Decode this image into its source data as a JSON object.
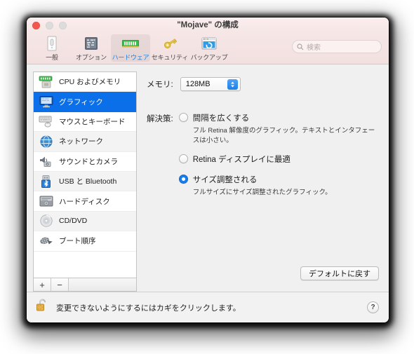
{
  "window": {
    "title": "\"Mojave\" の構成",
    "traffic_lights": [
      "close",
      "minimize",
      "zoom"
    ]
  },
  "toolbar": {
    "items": [
      {
        "label": "一般",
        "icon": "general-document-icon",
        "selected": false
      },
      {
        "label": "オプション",
        "icon": "options-circuit-icon",
        "selected": false
      },
      {
        "label": "ハードウェア",
        "icon": "hardware-memory-icon",
        "selected": true
      },
      {
        "label": "セキュリティ",
        "icon": "security-key-icon",
        "selected": false
      },
      {
        "label": "バックアップ",
        "icon": "backup-window-icon",
        "selected": false
      }
    ],
    "search": {
      "placeholder": "検索",
      "value": "",
      "icon": "search-icon"
    }
  },
  "sidebar": {
    "items": [
      {
        "label": "CPU およびメモリ",
        "icon": "cpu-memory-icon",
        "selected": false
      },
      {
        "label": "グラフィック",
        "icon": "display-icon",
        "selected": true
      },
      {
        "label": "マウスとキーボード",
        "icon": "keyboard-mouse-icon",
        "selected": false
      },
      {
        "label": "ネットワーク",
        "icon": "network-globe-icon",
        "selected": false
      },
      {
        "label": "サウンドとカメラ",
        "icon": "sound-camera-icon",
        "selected": false
      },
      {
        "label": "USB と Bluetooth",
        "icon": "usb-bluetooth-icon",
        "selected": false
      },
      {
        "label": "ハードディスク",
        "icon": "hard-disk-icon",
        "selected": false
      },
      {
        "label": "CD/DVD",
        "icon": "cd-dvd-icon",
        "selected": false
      },
      {
        "label": "ブート順序",
        "icon": "boot-order-icon",
        "selected": false
      }
    ],
    "add_label": "+",
    "remove_label": "−"
  },
  "main": {
    "memory_label": "メモリ:",
    "memory_value": "128MB",
    "resolution_label": "解決策:",
    "options": [
      {
        "label": "間隔を広くする",
        "description": "フル Retina 解像度のグラフィック。テキストとインタフェースは小さい。",
        "selected": false
      },
      {
        "label": "Retina ディスプレイに最適",
        "description": "",
        "selected": false
      },
      {
        "label": "サイズ調整される",
        "description": "フルサイズにサイズ調整されたグラフィック。",
        "selected": true
      }
    ],
    "default_button": "デフォルトに戻す"
  },
  "footer": {
    "lock_icon": "padlock-open-icon",
    "text": "変更できないようにするにはカギをクリックします。",
    "help_label": "?"
  },
  "colors": {
    "selection_blue": "#0a6fe8",
    "accent_blue": "#1d7fe8",
    "titlebar": "#f6e6e6",
    "content_bg": "#f0f0f0"
  }
}
